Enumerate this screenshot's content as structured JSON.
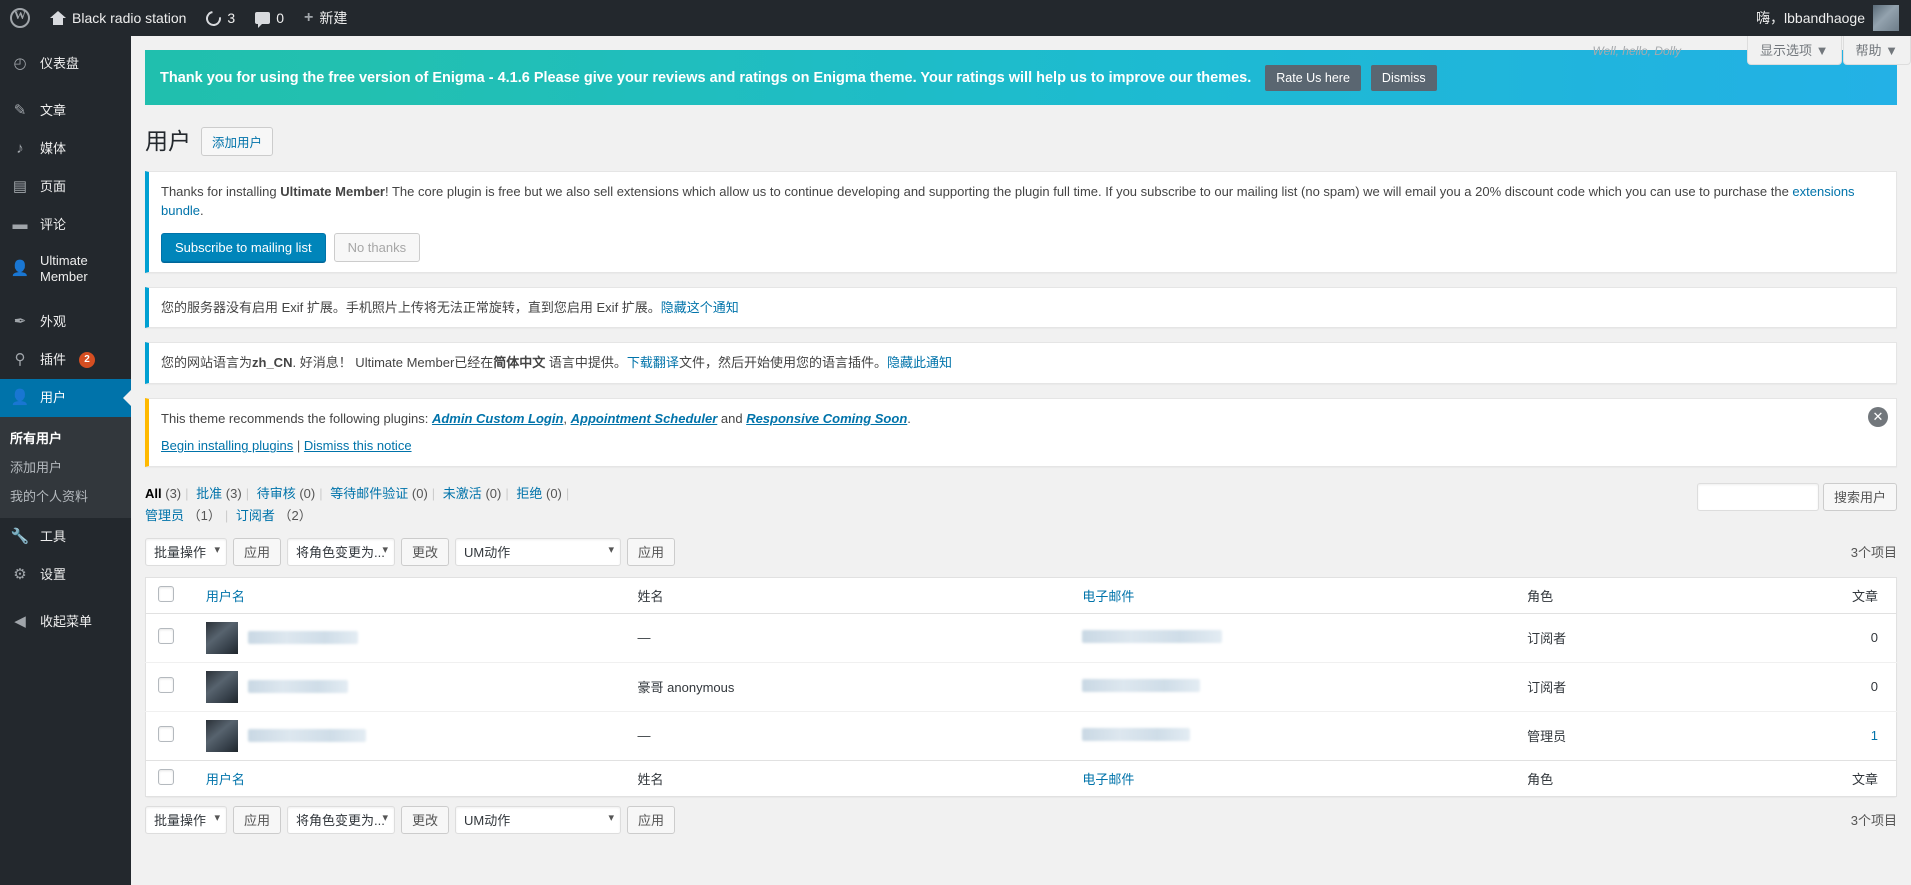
{
  "adminbar": {
    "logo_icon": "wordpress-logo-icon",
    "site_name": "Black radio station",
    "site_icon": "home-icon",
    "updates_icon": "updates-icon",
    "updates_count": "3",
    "comments_icon": "comment-bubble-icon",
    "comments_count": "0",
    "new_icon": "plus-icon",
    "new_label": "新建",
    "howdy": "嗨，lbbandhaoge",
    "avatar": "user-avatar"
  },
  "sidebar": {
    "items": [
      {
        "label": "仪表盘",
        "icon": "dashboard-icon",
        "name": "dashboard"
      },
      {
        "label": "文章",
        "icon": "pin-icon",
        "name": "posts"
      },
      {
        "label": "媒体",
        "icon": "media-icon",
        "name": "media"
      },
      {
        "label": "页面",
        "icon": "page-icon",
        "name": "pages"
      },
      {
        "label": "评论",
        "icon": "comment-icon",
        "name": "comments"
      },
      {
        "label": "Ultimate Member",
        "icon": "user-icon",
        "name": "ultimate-member"
      },
      {
        "label": "外观",
        "icon": "appearance-icon",
        "name": "appearance"
      },
      {
        "label": "插件",
        "icon": "plugins-icon",
        "name": "plugins",
        "badge": "2"
      },
      {
        "label": "用户",
        "icon": "users-icon",
        "name": "users",
        "active": true
      },
      {
        "label": "工具",
        "icon": "tools-icon",
        "name": "tools"
      },
      {
        "label": "设置",
        "icon": "settings-icon",
        "name": "settings"
      },
      {
        "label": "收起菜单",
        "icon": "collapse-icon",
        "name": "collapse-menu"
      }
    ],
    "submenu": [
      {
        "label": "所有用户",
        "current": true
      },
      {
        "label": "添加用户",
        "current": false
      },
      {
        "label": "我的个人资料",
        "current": false
      }
    ]
  },
  "screen_meta": {
    "dolly": "Well, hello, Dolly",
    "screen_options": "显示选项 ▼",
    "help": "帮助 ▼"
  },
  "enigma_banner": {
    "message": "Thank you for using the free version of Enigma - 4.1.6 Please give your reviews and ratings on Enigma theme. Your ratings will help us to improve our themes.",
    "rate_label": "Rate Us here",
    "dismiss_label": "Dismiss",
    "gradient_from": "#20bfae",
    "gradient_to": "#23b1e6"
  },
  "page": {
    "title": "用户",
    "add_button": "添加用户"
  },
  "notices": {
    "ultimate_member": {
      "text_1": "Thanks for installing ",
      "strong": "Ultimate Member",
      "text_2": "! The core plugin is free but we also sell extensions which allow us to continue developing and supporting the plugin full time. If you subscribe to our mailing list (no spam) we will email you a 20% discount code which you can use to purchase the ",
      "link": "extensions bundle",
      "text_3": ".",
      "subscribe_label": "Subscribe to mailing list",
      "no_thanks_label": "No thanks"
    },
    "exif": {
      "text": "您的服务器没有启用 Exif 扩展。手机照片上传将无法正常旋转，直到您启用 Exif 扩展。",
      "link": "隐藏这个通知"
    },
    "language": {
      "text_1": "您的网站语言为",
      "strong_1": "zh_CN",
      "text_2": ". 好消息！ Ultimate Member已经在",
      "strong_2": "简体中文",
      "text_3": " 语言中提供。",
      "link_1": "下载翻译",
      "text_4": "文件，然后开始使用您的语言插件。",
      "link_2": "隐藏此通知"
    },
    "tgm": {
      "text_1": "This theme recommends the following plugins: ",
      "plugin_1": "Admin Custom Login",
      "sep_1": ", ",
      "plugin_2": "Appointment Scheduler",
      "sep_2": " and ",
      "plugin_3": "Responsive Coming Soon",
      "text_2": ".",
      "begin_label": "Begin installing plugins",
      "pipe": "|",
      "dismiss_label": "Dismiss this notice",
      "close_icon": "close-icon"
    }
  },
  "filters": {
    "links": [
      {
        "label": "All",
        "count": "(3)",
        "current": true
      },
      {
        "label": "批准",
        "count": "(3)",
        "current": false
      },
      {
        "label": "待审核",
        "count": "(0)",
        "current": false
      },
      {
        "label": "等待邮件验证",
        "count": "(0)",
        "current": false
      },
      {
        "label": "未激活",
        "count": "(0)",
        "current": false
      },
      {
        "label": "拒绝",
        "count": "(0)",
        "current": false
      }
    ],
    "roles": [
      {
        "label": "管理员",
        "count": "（1）"
      },
      {
        "label": "订阅者",
        "count": "（2）"
      }
    ]
  },
  "search": {
    "value": "",
    "placeholder": "",
    "button_label": "搜索用户"
  },
  "tablenav": {
    "bulk_select": "批量操作",
    "bulk_apply": "应用",
    "role_select": "将角色变更为...",
    "role_change": "更改",
    "um_select": "UM动作",
    "um_apply": "应用",
    "items_count": "3个项目"
  },
  "table": {
    "columns": {
      "username": "用户名",
      "fullname": "姓名",
      "email": "电子邮件",
      "role": "角色",
      "posts": "文章"
    },
    "rows": [
      {
        "username_blurred": true,
        "username_width": 110,
        "fullname": "—",
        "email_blurred": true,
        "email_width": 140,
        "role": "订阅者",
        "posts": "0",
        "posts_link": false
      },
      {
        "username_blurred": true,
        "username_width": 100,
        "fullname": "豪哥 anonymous",
        "email_blurred": true,
        "email_width": 118,
        "role": "订阅者",
        "posts": "0",
        "posts_link": false
      },
      {
        "username_blurred": true,
        "username_width": 118,
        "fullname": "—",
        "email_blurred": true,
        "email_width": 108,
        "role": "管理员",
        "posts": "1",
        "posts_link": true
      }
    ]
  }
}
